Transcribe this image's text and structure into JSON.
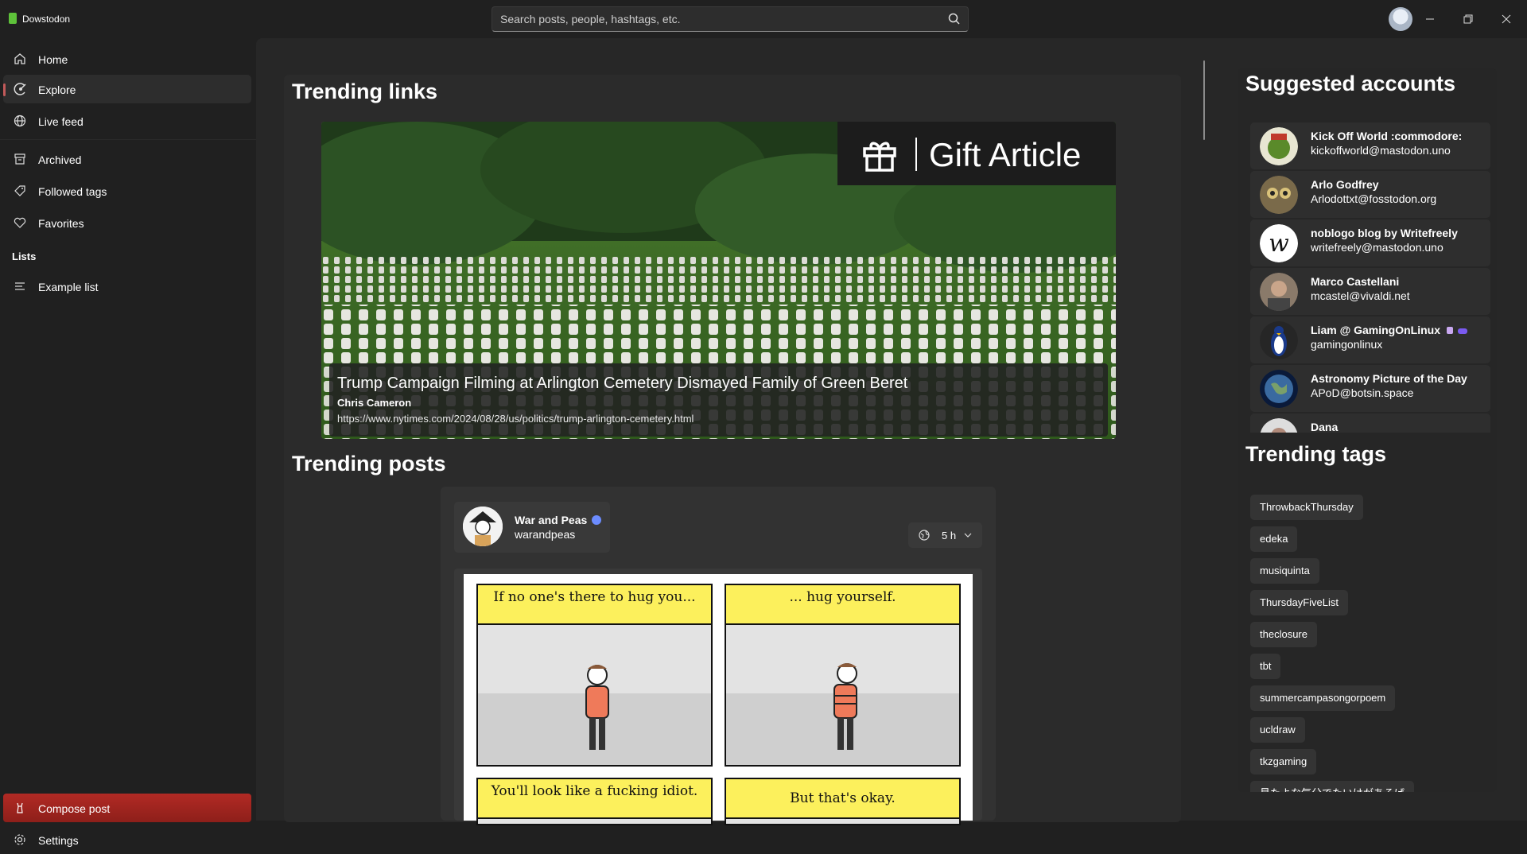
{
  "app": {
    "name": "Dowstodon"
  },
  "search": {
    "placeholder": "Search posts, people, hashtags, etc."
  },
  "sidebar": {
    "items": [
      {
        "label": "Home",
        "icon": "home-icon"
      },
      {
        "label": "Explore",
        "icon": "explore-icon",
        "active": true
      },
      {
        "label": "Live feed",
        "icon": "globe-icon"
      },
      {
        "label": "Archived",
        "icon": "archive-icon"
      },
      {
        "label": "Followed tags",
        "icon": "tag-icon"
      },
      {
        "label": "Favorites",
        "icon": "heart-icon"
      }
    ],
    "lists_header": "Lists",
    "lists": [
      {
        "label": "Example list",
        "icon": "list-icon"
      }
    ],
    "compose_label": "Compose post",
    "settings_label": "Settings"
  },
  "main": {
    "trending_links_title": "Trending links",
    "link": {
      "title": "Trump Campaign Filming at Arlington Cemetery Dismayed Family of Green Beret",
      "author": "Chris Cameron",
      "url": "https://www.nytimes.com/2024/08/28/us/politics/trump-arlington-cemetery.html",
      "banner_text": "Gift Article"
    },
    "trending_posts_title": "Trending posts",
    "post": {
      "name": "War and Peas",
      "handle": "warandpeas",
      "time": "5 h",
      "comic": {
        "panel1": "If no one's there to hug you...",
        "panel2": "... hug yourself.",
        "panel3": "You'll look like a fucking idiot.",
        "panel4": "But that's okay."
      }
    }
  },
  "right": {
    "suggested_title": "Suggested accounts",
    "accounts": [
      {
        "name": "Kick Off World :commodore:",
        "handle": "kickoffworld@mastodon.uno"
      },
      {
        "name": "Arlo Godfrey",
        "handle": "Arlodottxt@fosstodon.org"
      },
      {
        "name": "noblogo blog by Writefreely",
        "handle": "writefreely@mastodon.uno"
      },
      {
        "name": "Marco Castellani",
        "handle": "mcastel@vivaldi.net"
      },
      {
        "name": "Liam @ GamingOnLinux",
        "handle": "gamingonlinux"
      },
      {
        "name": "Astronomy Picture of the Day",
        "handle": "APoD@botsin.space"
      },
      {
        "name": "Dana",
        "handle": ""
      }
    ],
    "trending_tags_title": "Trending tags",
    "tags": [
      "ThrowbackThursday",
      "edeka",
      "musiquinta",
      "ThursdayFiveList",
      "theclosure",
      "tbt",
      "summercampasongorpoem",
      "ucldraw",
      "tkzgaming",
      "見たよな気分でたいけがあるげ"
    ]
  },
  "colors": {
    "accent": "#c25a5a",
    "compose": "#a8261f",
    "brand": "#5ec23a"
  }
}
